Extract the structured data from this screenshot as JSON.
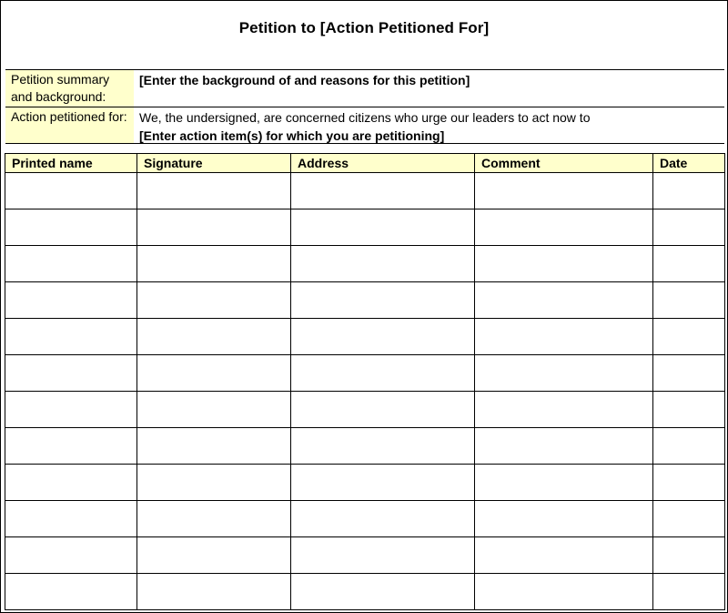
{
  "title": "Petition to [Action Petitioned For]",
  "summary": {
    "background_label": "Petition summary and background:",
    "background_value": "[Enter the background of and reasons for this petition]",
    "action_label": "Action petitioned for:",
    "action_line1": "We, the undersigned, are concerned citizens who urge our leaders to act now to",
    "action_line2": "[Enter action item(s) for which you are petitioning]"
  },
  "table": {
    "columns": [
      "Printed name",
      "Signature",
      "Address",
      "Comment",
      "Date"
    ],
    "row_count": 12
  },
  "colors": {
    "label_background": "#ffffcc",
    "border": "#000000"
  }
}
